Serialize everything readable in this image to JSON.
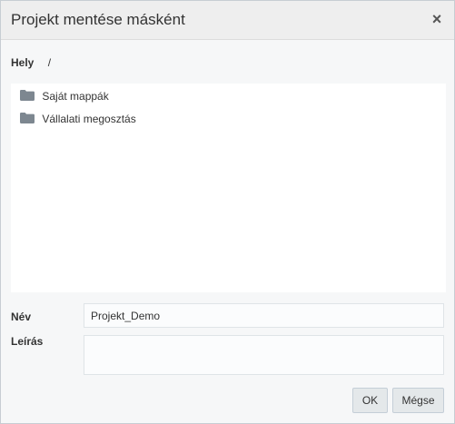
{
  "dialog": {
    "title": "Projekt mentése másként",
    "close_symbol": "×"
  },
  "location": {
    "label": "Hely",
    "path": "/"
  },
  "folders": [
    {
      "label": "Saját mappák",
      "icon": "folder-icon"
    },
    {
      "label": "Vállalati megosztás",
      "icon": "folder-icon"
    }
  ],
  "form": {
    "name_label": "Név",
    "name_value": "Projekt_Demo",
    "description_label": "Leírás",
    "description_value": ""
  },
  "buttons": {
    "ok_label": "OK",
    "cancel_label": "Mégse"
  },
  "colors": {
    "folder_icon": "#7d8790",
    "header_bg": "#eeeeee",
    "dialog_bg": "#f6f7f8"
  }
}
